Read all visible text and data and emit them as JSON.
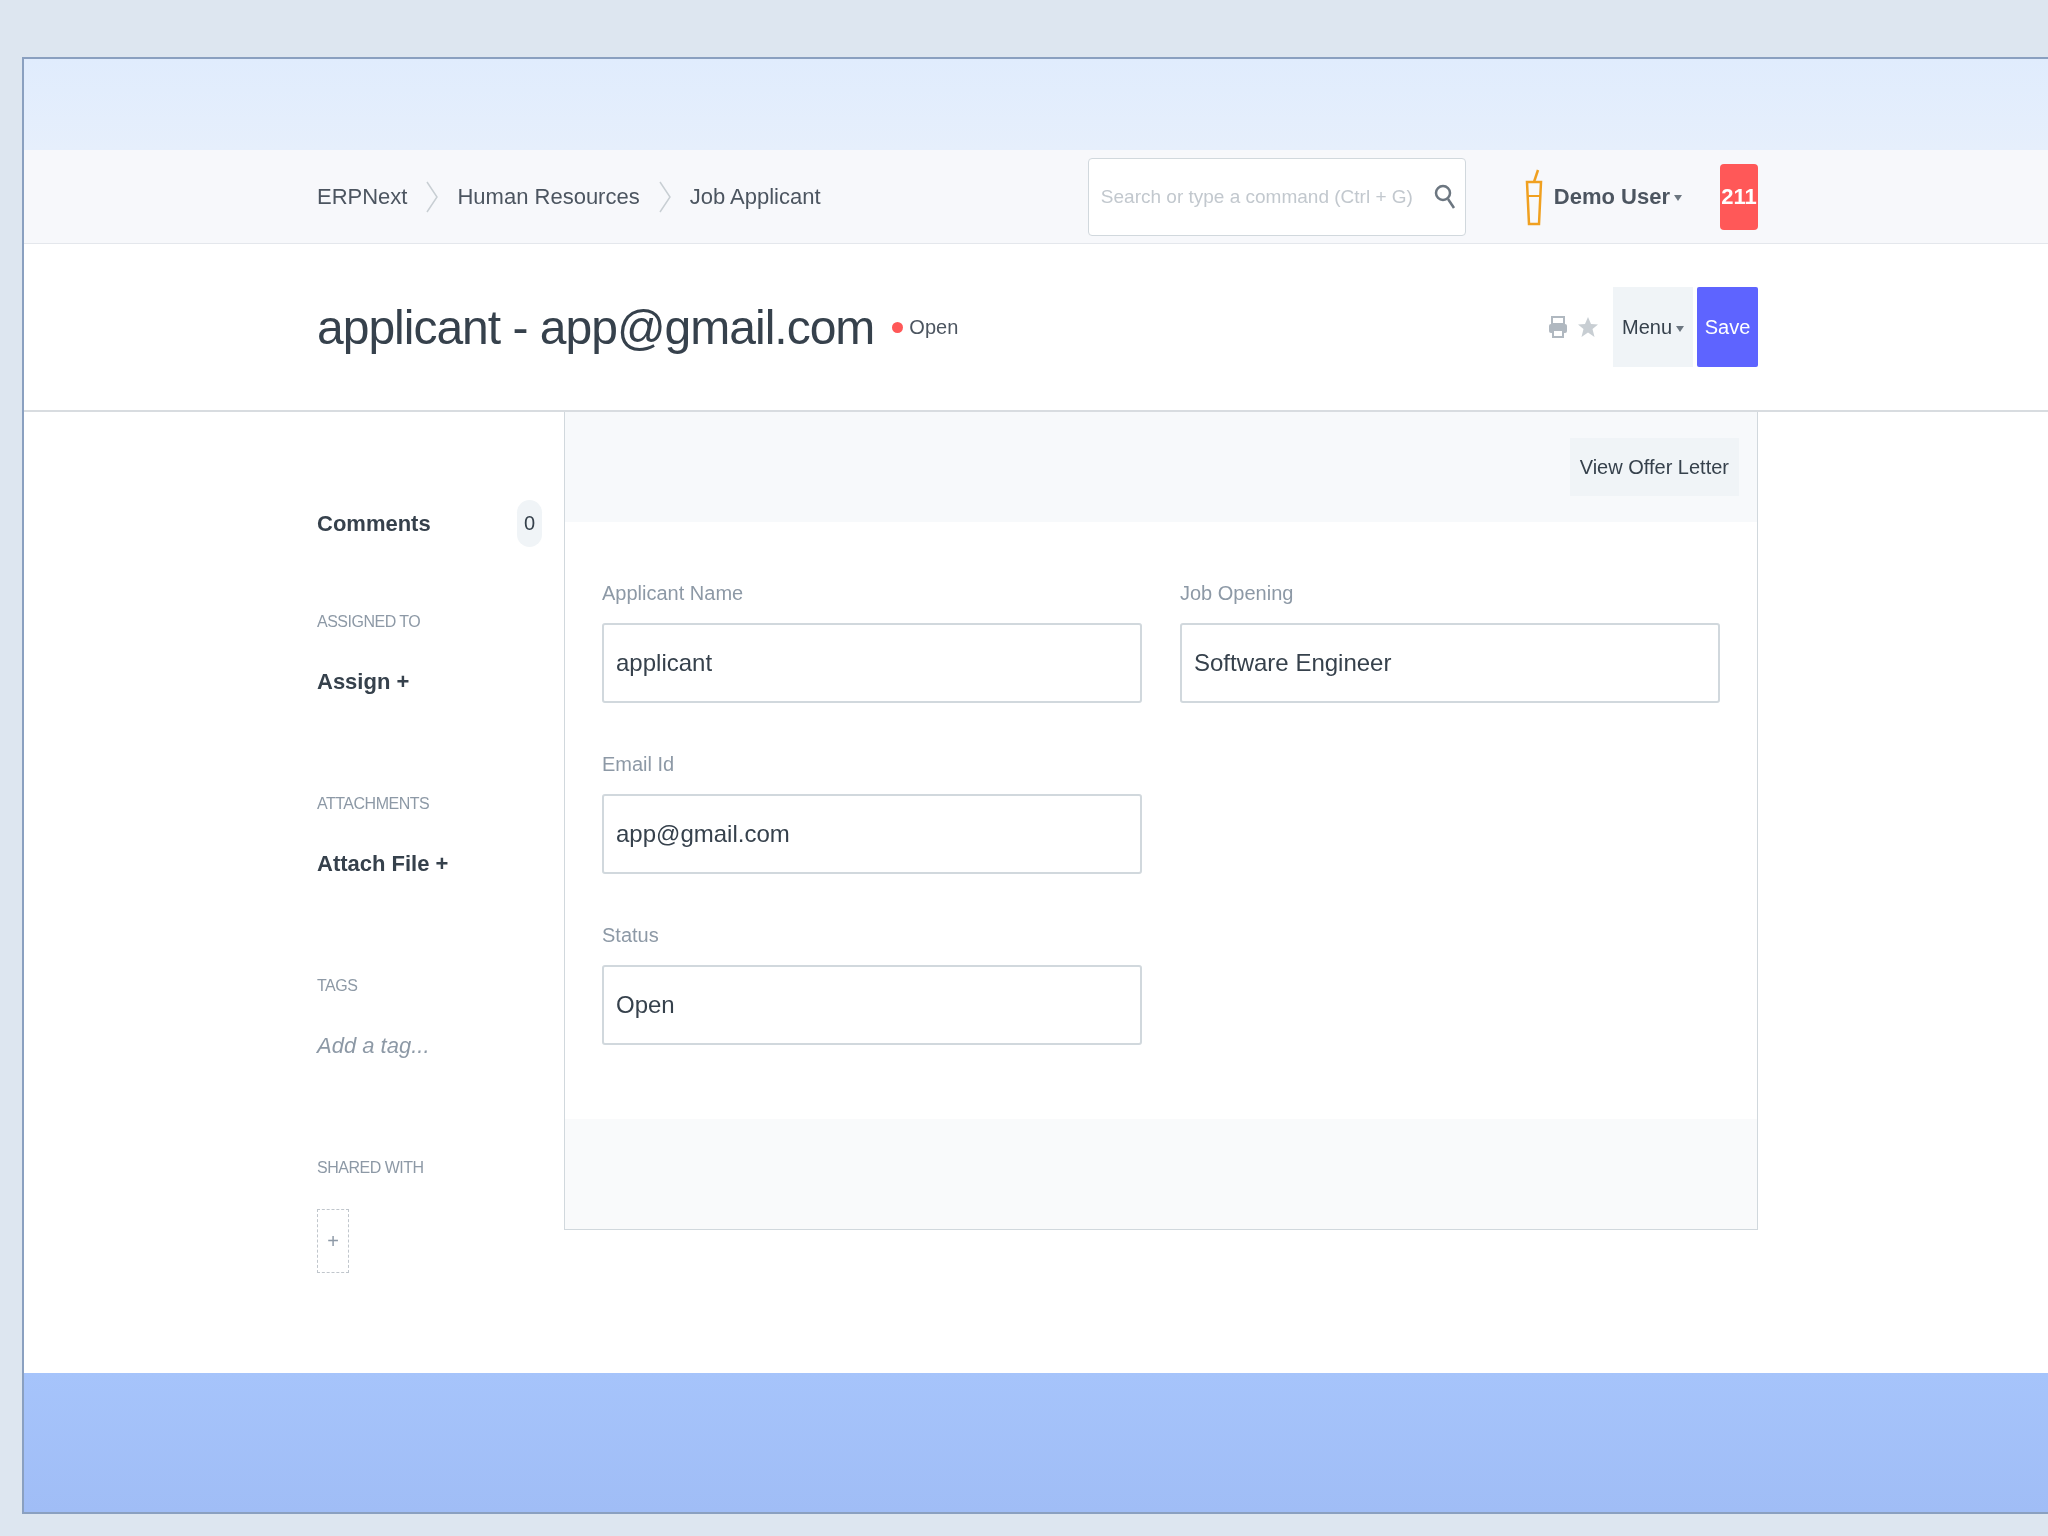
{
  "breadcrumbs": [
    {
      "label": "ERPNext"
    },
    {
      "label": "Human Resources"
    },
    {
      "label": "Job Applicant"
    }
  ],
  "search": {
    "placeholder": "Search or type a command (Ctrl + G)"
  },
  "user": {
    "name": "Demo User",
    "notifications": "211"
  },
  "page": {
    "title": "applicant - app@gmail.com",
    "status": "Open"
  },
  "actions": {
    "menu": "Menu",
    "save": "Save"
  },
  "sidebar": {
    "comments": {
      "label": "Comments",
      "count": "0"
    },
    "sections": [
      {
        "kind": "link",
        "heading": "ASSIGNED TO",
        "text": "Assign +"
      },
      {
        "kind": "link",
        "heading": "ATTACHMENTS",
        "text": "Attach File +"
      },
      {
        "kind": "tag",
        "heading": "TAGS",
        "text": "Add a tag..."
      },
      {
        "kind": "share",
        "heading": "SHARED WITH",
        "text": "+"
      }
    ]
  },
  "form": {
    "toolbar_button": "View Offer Letter",
    "fields": [
      {
        "label": "Applicant Name",
        "value": "applicant"
      },
      {
        "label": "Job Opening",
        "value": "Software Engineer"
      },
      {
        "label": "Email Id",
        "value": "app@gmail.com"
      },
      {
        "label": "Status",
        "value": "Open"
      }
    ]
  }
}
